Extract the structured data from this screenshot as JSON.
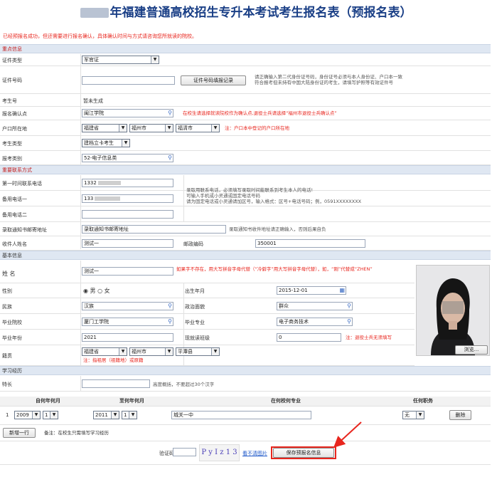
{
  "title_year_hidden": "",
  "title": "年福建普通高校招生专升本考试考生报名表（预报名表）",
  "notice": "已经预报名成功，但还需要进行报名确认，具体确认时间与方式请咨询您所就读的院校。",
  "sections": {
    "key_info": "重点信息",
    "contact": "重要联系方式",
    "basic": "基本信息",
    "study": "学习经历"
  },
  "key_info": {
    "id_type_label": "证件类型",
    "id_type_value": "军官证",
    "id_number_label": "证件号码",
    "id_button": "证件号码填报记录",
    "id_hint": "请正确输入第二代身份证号码，身份证号必须与本人身份证、户口本一致\n符合报考但未持有中国大陆身份证的考生，请填写护照等有效证件号",
    "exam_no_label": "考生号",
    "exam_no_value": "暂未生成",
    "confirm_point_label": "报名确认点",
    "confirm_point_value": "闽江学院",
    "confirm_point_hint": "在校生请选择就读院校作为确认点,退役士兵请选择“福州市退役士兵确认点”",
    "hukou_label": "户口所在地",
    "hukou_province": "福建省",
    "hukou_city": "福州市",
    "hukou_county": "福清市",
    "hukou_hint": "注：户口本中登记的户口所在地",
    "exam_type_label": "考生类型",
    "exam_type_value": "建档立卡考生",
    "category_label": "报考类别",
    "category_value": "52-电子信息类"
  },
  "contact": {
    "phone1_label": "第一时间联系电话",
    "phone1_value": "1332",
    "phone2_label": "备用电话一",
    "phone2_value": "133",
    "phone3_label": "备用电话二",
    "phone3_value": "",
    "phone_hint": "录取用联系电话，必须填写录取时间能联系到考生本人的电话!\n可输入手机或小灵通或固定电话号码\n请为固定电话或小灵通请加区号，输入格式：区号+电话号码；例，0591XXXXXXXX",
    "mail_addr_label": "录取通知书邮寄地址",
    "mail_addr_value": "录取通知书邮寄地址",
    "mail_addr_hint": "录取通知书收件地址请正确输入，否则后果自负",
    "receiver_label": "收件人姓名",
    "receiver_value": "测试一",
    "postcode_label": "邮政编码",
    "postcode_value": "350001"
  },
  "basic": {
    "name_label": "姓 名",
    "name_value": "测试一",
    "name_hint": "如果字不存在，用大写拼音字母代替（“冷僻字”用大写拼音字母代替），如，“刚”代替成“ZHEN”",
    "gender_label": "性别",
    "gender_male": "男",
    "gender_female": "女",
    "birth_label": "出生年月",
    "birth_value": "2015-12-01",
    "nation_label": "民族",
    "nation_value": "汉族",
    "political_label": "政治面貌",
    "political_value": "群众",
    "school_label": "毕业院校",
    "school_value": "厦门工学院",
    "major_label": "毕业专业",
    "major_value": "电子商务技术",
    "grad_year_label": "毕业年份",
    "grad_year_value": "2021",
    "current_class_label": "现就读班级",
    "current_class_value": "0",
    "current_class_hint": "注：退役士兵无须填写",
    "native_label": "籍贯",
    "native_province": "福建省",
    "native_city": "福州市",
    "native_county": "平潭县",
    "native_hint": "注：指祖居（祖籍地）或原籍",
    "browse_button": "浏览..."
  },
  "study": {
    "specialty_label": "特长",
    "specialty_value": "",
    "specialty_hint": "高度概括，不要超过30个汉字",
    "columns": [
      "自何年何月",
      "至何年何月",
      "在何校何专业",
      "任何职务"
    ],
    "rows": [
      {
        "index": "1",
        "from_year": "2009",
        "from_month": "1",
        "to_year": "2011",
        "to_month": "1",
        "school": "城关一中",
        "duty": "无",
        "delete": "删除"
      }
    ],
    "add_button": "新增一行",
    "add_note": "备注：在校生只需填写学习经历"
  },
  "footer": {
    "captcha_label": "验证码",
    "captcha_value": "",
    "captcha_text": "P y  I  z  1  3",
    "refresh_link": "看不清图片",
    "save_button": "保存预报名信息"
  },
  "colors": {
    "title": "#1a3f86",
    "section_bg": "#dfe7f2",
    "warning": "#e8261e",
    "link": "#1a55c8",
    "annotation_red": "#e8261e"
  }
}
